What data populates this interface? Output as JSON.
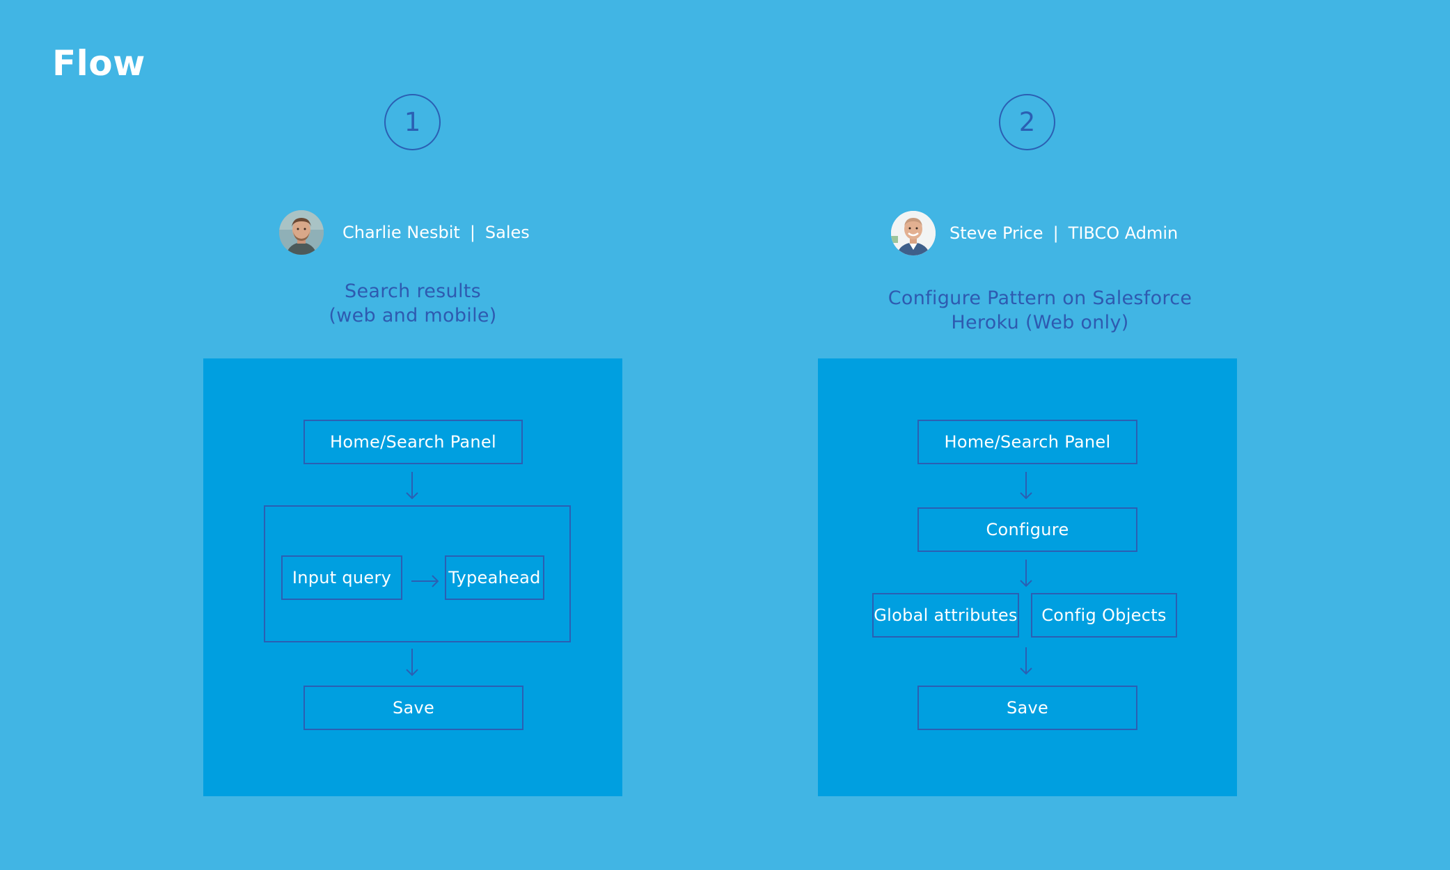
{
  "title": "Flow",
  "flows": [
    {
      "step": "1",
      "persona": {
        "name": "Charlie Nesbit",
        "separator": "|",
        "role": "Sales"
      },
      "subtitle": {
        "line1": "Search results",
        "line2": "(web and mobile)"
      },
      "nodes": {
        "home": "Home/Search Panel",
        "input": "Input query",
        "typeahead": "Typeahead",
        "save": "Save"
      }
    },
    {
      "step": "2",
      "persona": {
        "name": "Steve Price",
        "separator": "|",
        "role": "TIBCO Admin"
      },
      "subtitle": {
        "line1": "Configure Pattern on Salesforce",
        "line2": "Heroku (Web only)"
      },
      "nodes": {
        "home": "Home/Search Panel",
        "configure": "Configure",
        "global": "Global attributes",
        "objects": "Config Objects",
        "save": "Save"
      }
    }
  ],
  "colors": {
    "background": "#41b5e4",
    "panel": "#009fe0",
    "outline": "#2b5fb3",
    "subtitle": "#2e5ab0"
  }
}
